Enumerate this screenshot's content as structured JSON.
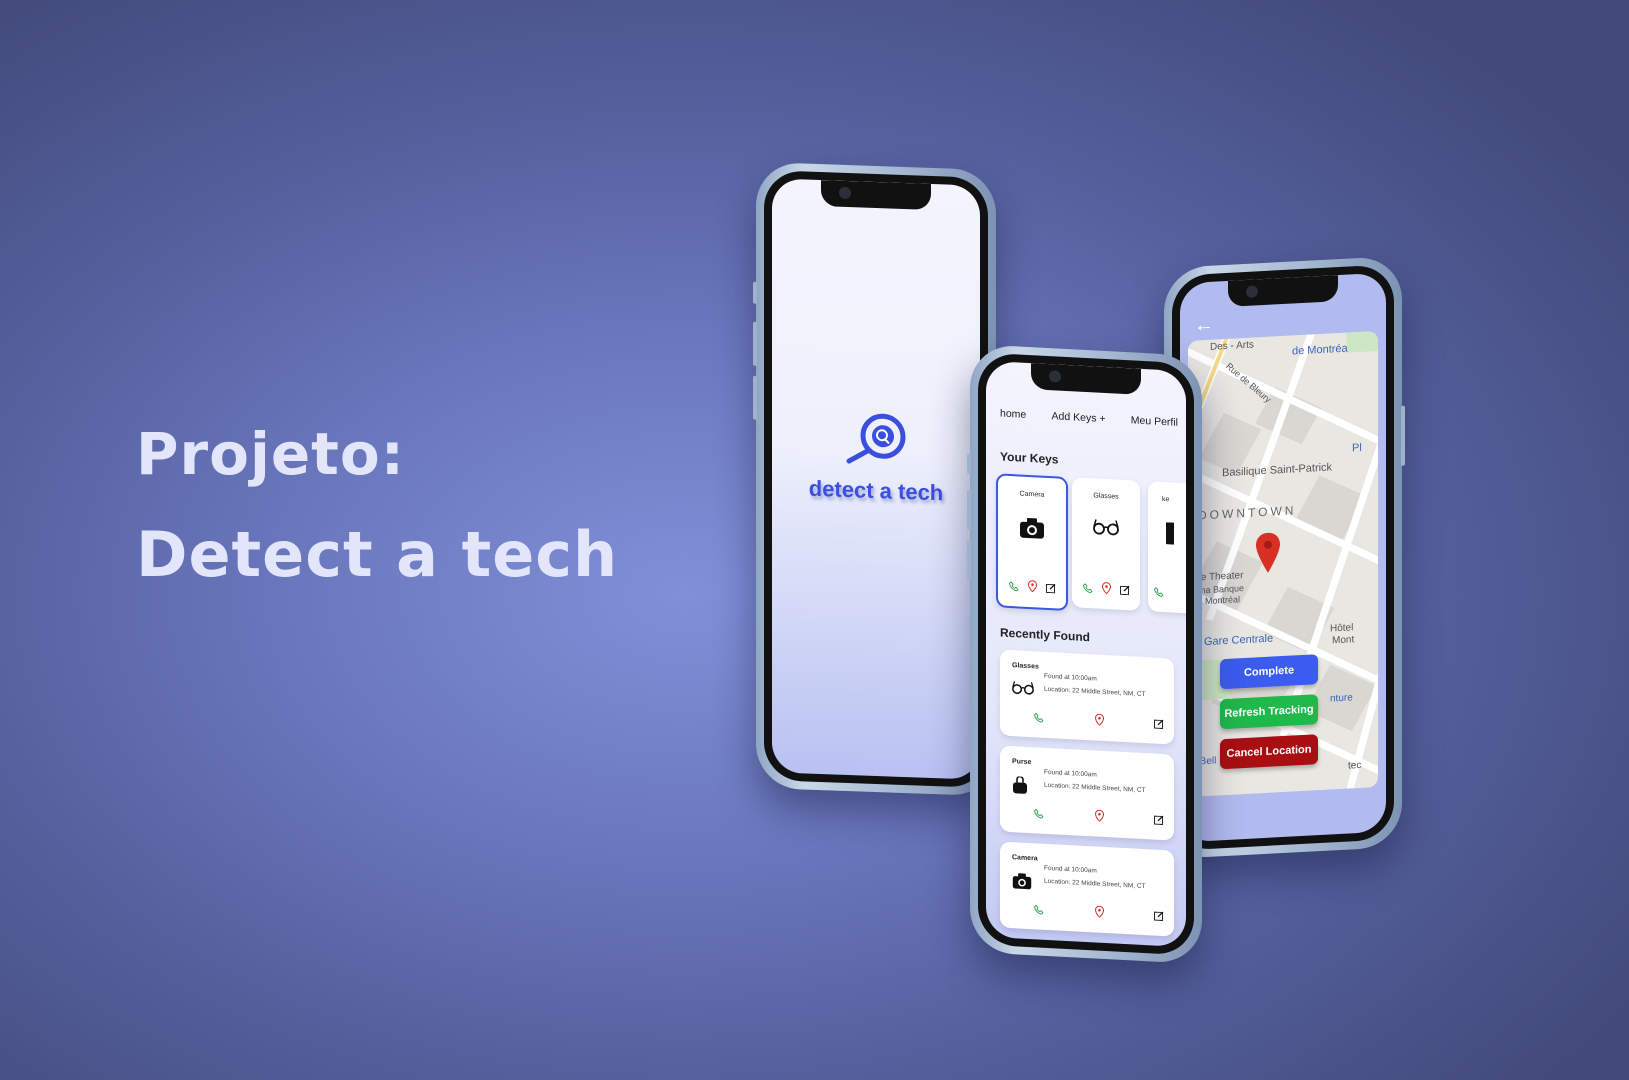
{
  "hero": {
    "line1": "Projeto:",
    "line2": "Detect a tech"
  },
  "splash": {
    "logo_text": "detect a tech"
  },
  "home": {
    "nav": [
      "home",
      "Add Keys +",
      "Meu Perfil"
    ],
    "your_keys_title": "Your Keys",
    "keys": [
      {
        "name": "Camera",
        "icon": "camera-icon",
        "selected": true
      },
      {
        "name": "Glasses",
        "icon": "glasses-icon",
        "selected": false
      },
      {
        "name": "ke",
        "icon": "key-icon",
        "selected": false
      }
    ],
    "recently_found_title": "Recently Found",
    "found": [
      {
        "name": "Glasses",
        "icon": "glasses-icon",
        "time": "Found at 10:00am",
        "location": "Location: 22 Middle Street, NM, CT"
      },
      {
        "name": "Purse",
        "icon": "purse-icon",
        "time": "Found at 10:00am",
        "location": "Location: 22 Middle Street, NM, CT"
      },
      {
        "name": "Camera",
        "icon": "camera-icon",
        "time": "Found at 10:00am",
        "location": "Location: 22 Middle Street, NM, CT"
      }
    ]
  },
  "tracking": {
    "map_labels": [
      "Des - Arts",
      "de Montréa",
      "Rue de Bleury",
      "Basilique Saint-Patrick",
      "DOWNTOWN",
      "ovie Theater",
      "néma Banque",
      "otia Montréal",
      "Gare Centrale",
      "Hôtel",
      "Mont",
      "Pl",
      "nture",
      "re Bell",
      "tec"
    ],
    "buttons": {
      "complete": "Complete",
      "refresh": "Refresh Tracking",
      "cancel": "Cancel Location"
    }
  },
  "colors": {
    "accent": "#3b4fdf",
    "complete": "#3c5cf0",
    "refresh": "#1fb84a",
    "cancel": "#a80f12",
    "background": "#6a77bd"
  }
}
